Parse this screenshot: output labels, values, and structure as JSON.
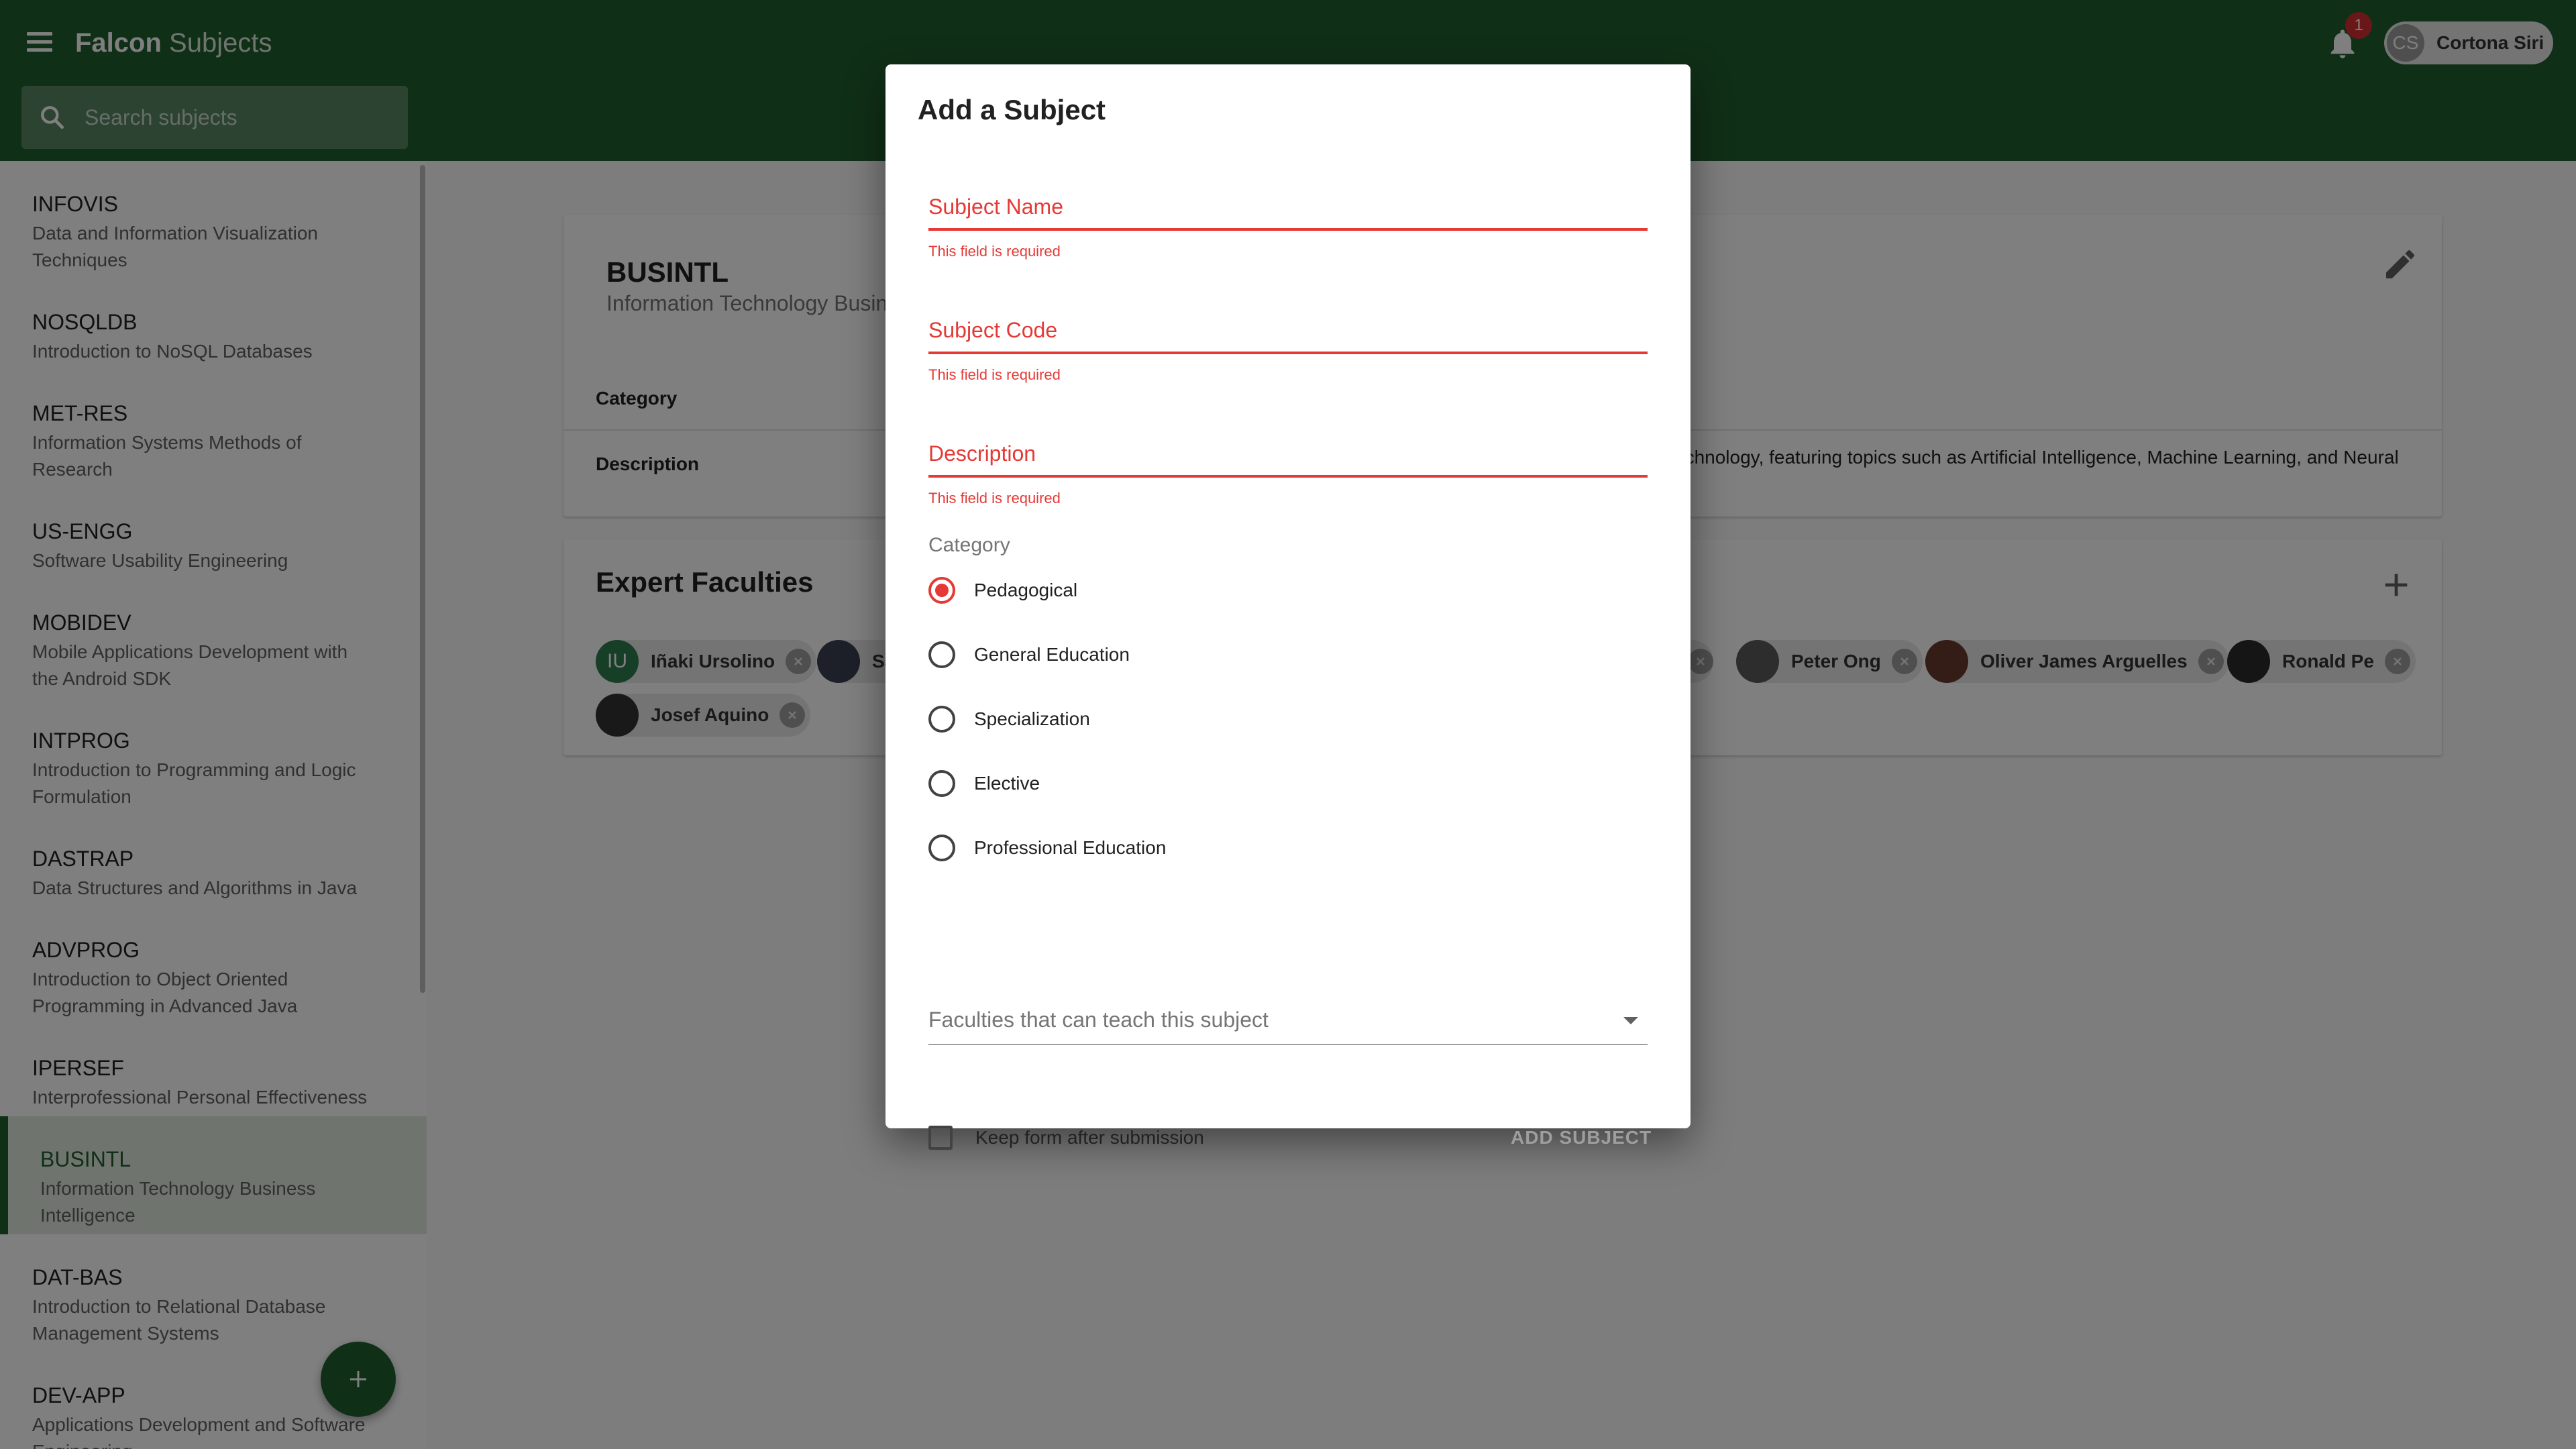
{
  "app": {
    "brand_bold": "Falcon",
    "brand_thin": "Subjects",
    "notification_count": "1",
    "user_initials": "CS",
    "user_name": "Cortona Siri"
  },
  "search": {
    "placeholder": "Search subjects"
  },
  "sidebar": {
    "items": [
      {
        "code": "INFOVIS",
        "desc1": "Data and Information Visualization",
        "desc2": "Techniques"
      },
      {
        "code": "NOSQLDB",
        "desc1": "Introduction to NoSQL Databases",
        "desc2": ""
      },
      {
        "code": "MET-RES",
        "desc1": "Information Systems Methods of",
        "desc2": "Research"
      },
      {
        "code": "US-ENGG",
        "desc1": "Software Usability Engineering",
        "desc2": ""
      },
      {
        "code": "MOBIDEV",
        "desc1": "Mobile Applications Development with",
        "desc2": "the Android SDK"
      },
      {
        "code": "INTPROG",
        "desc1": "Introduction to Programming and Logic",
        "desc2": "Formulation"
      },
      {
        "code": "DASTRAP",
        "desc1": "Data Structures and Algorithms in Java",
        "desc2": ""
      },
      {
        "code": "ADVPROG",
        "desc1": "Introduction to Object Oriented",
        "desc2": "Programming in Advanced Java"
      },
      {
        "code": "IPERSEF",
        "desc1": "Interprofessional Personal Effectiveness",
        "desc2": ""
      },
      {
        "code": "BUSINTL",
        "desc1": "Information Technology Business",
        "desc2": "Intelligence"
      },
      {
        "code": "DAT-BAS",
        "desc1": "Introduction to Relational Database",
        "desc2": "Management Systems"
      },
      {
        "code": "DEV-APP",
        "desc1": "Applications Development and Software",
        "desc2": "Engineering"
      }
    ]
  },
  "detail": {
    "code": "BUSINTL",
    "name": "Information Technology Business Intelligence",
    "category_label": "Category",
    "description_label": "Description",
    "description_visible": "echnology, featuring topics such as Artificial Intelligence, Machine Learning, and Neural"
  },
  "faculties": {
    "title": "Expert Faculties",
    "chips": [
      {
        "initials": "IU",
        "name": "Iñaki Ursolino"
      },
      {
        "initials": "",
        "name": "Sa"
      },
      {
        "initials": "",
        "name": ""
      },
      {
        "initials": "",
        "name": "Peter Ong"
      },
      {
        "initials": "",
        "name": "Oliver James Arguelles"
      },
      {
        "initials": "",
        "name": "Ronald Pe"
      },
      {
        "initials": "",
        "name": "Josef Aquino"
      }
    ]
  },
  "dialog": {
    "title": "Add a Subject",
    "fields": [
      {
        "label": "Subject Name",
        "error": "This field is required"
      },
      {
        "label": "Subject Code",
        "error": "This field is required"
      },
      {
        "label": "Description",
        "error": "This field is required"
      }
    ],
    "category_label": "Category",
    "categories": [
      "Pedagogical",
      "General Education",
      "Specialization",
      "Elective",
      "Professional Education"
    ],
    "selected_category": "Pedagogical",
    "faculties_placeholder": "Faculties that can teach this subject",
    "keep_form_label": "Keep form after submission",
    "submit_label": "ADD SUBJECT"
  },
  "colors": {
    "primary": "#215f2f",
    "error": "#e53935",
    "badge": "#d32f2f"
  }
}
